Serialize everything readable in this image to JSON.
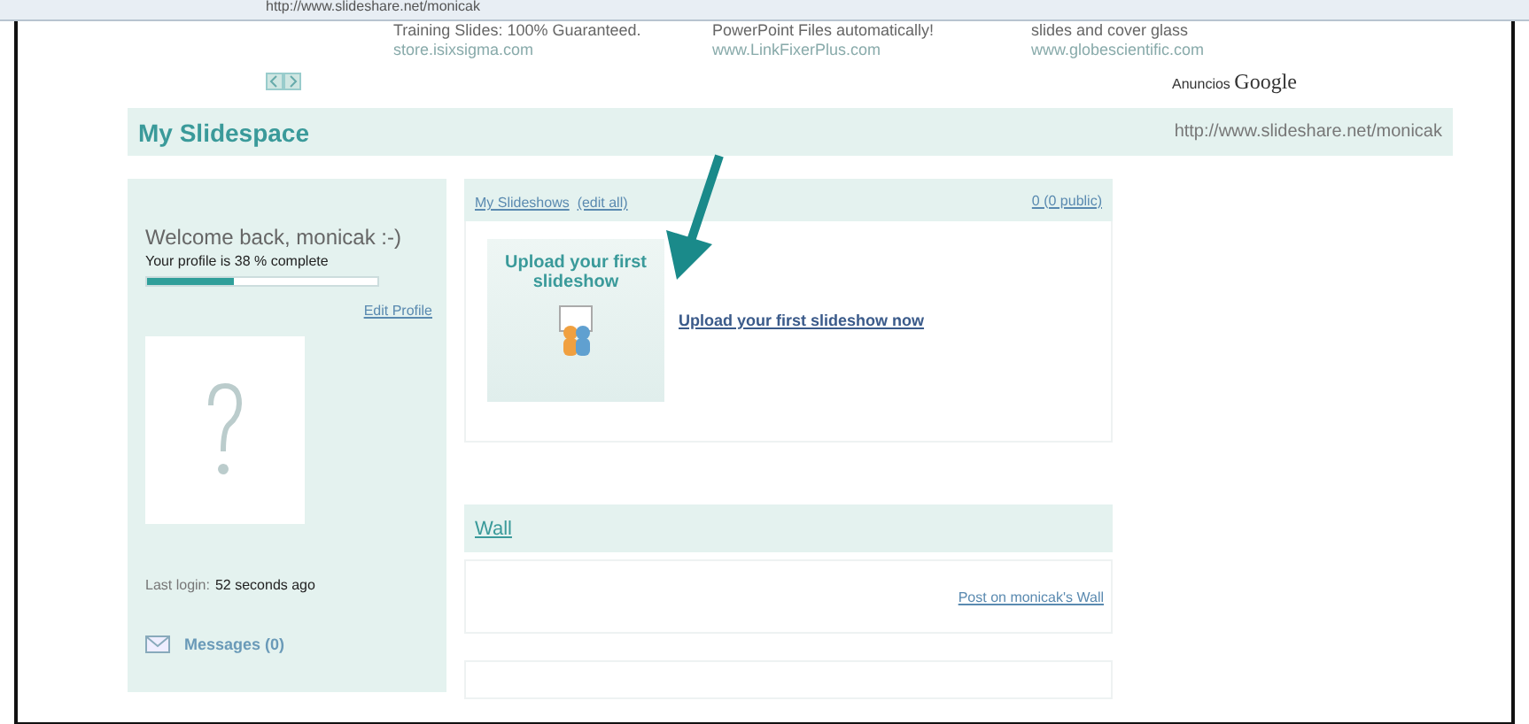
{
  "address_bar": {
    "url": "http://www.slideshare.net/monicak"
  },
  "ads": [
    {
      "title": "Training Slides: 100% Guaranteed.",
      "url": "store.isixsigma.com"
    },
    {
      "title": "PowerPoint Files automatically!",
      "url": "www.LinkFixerPlus.com"
    },
    {
      "title": "slides and cover glass",
      "url": "www.globescientific.com"
    }
  ],
  "ads_label": {
    "prefix": "Anuncios",
    "brand": "Google"
  },
  "header": {
    "title": "My Slidespace",
    "url": "http://www.slideshare.net/monicak"
  },
  "profile": {
    "welcome": "Welcome back, monicak :-)",
    "completion": "Your profile is 38 % complete",
    "level": 0.38,
    "edit": "Edit Profile",
    "last_login_label": "Last login:",
    "last_login": "52 seconds ago",
    "messages": "Messages (0)"
  },
  "slideshows": {
    "title": "My Slideshows",
    "edit": "(edit all)",
    "count": "0 (0 public)",
    "upload_tile": "Upload your first slideshow",
    "upload_link": "Upload your first slideshow now"
  },
  "wall": {
    "title": "Wall",
    "post_link": "Post on monicak's Wall"
  }
}
